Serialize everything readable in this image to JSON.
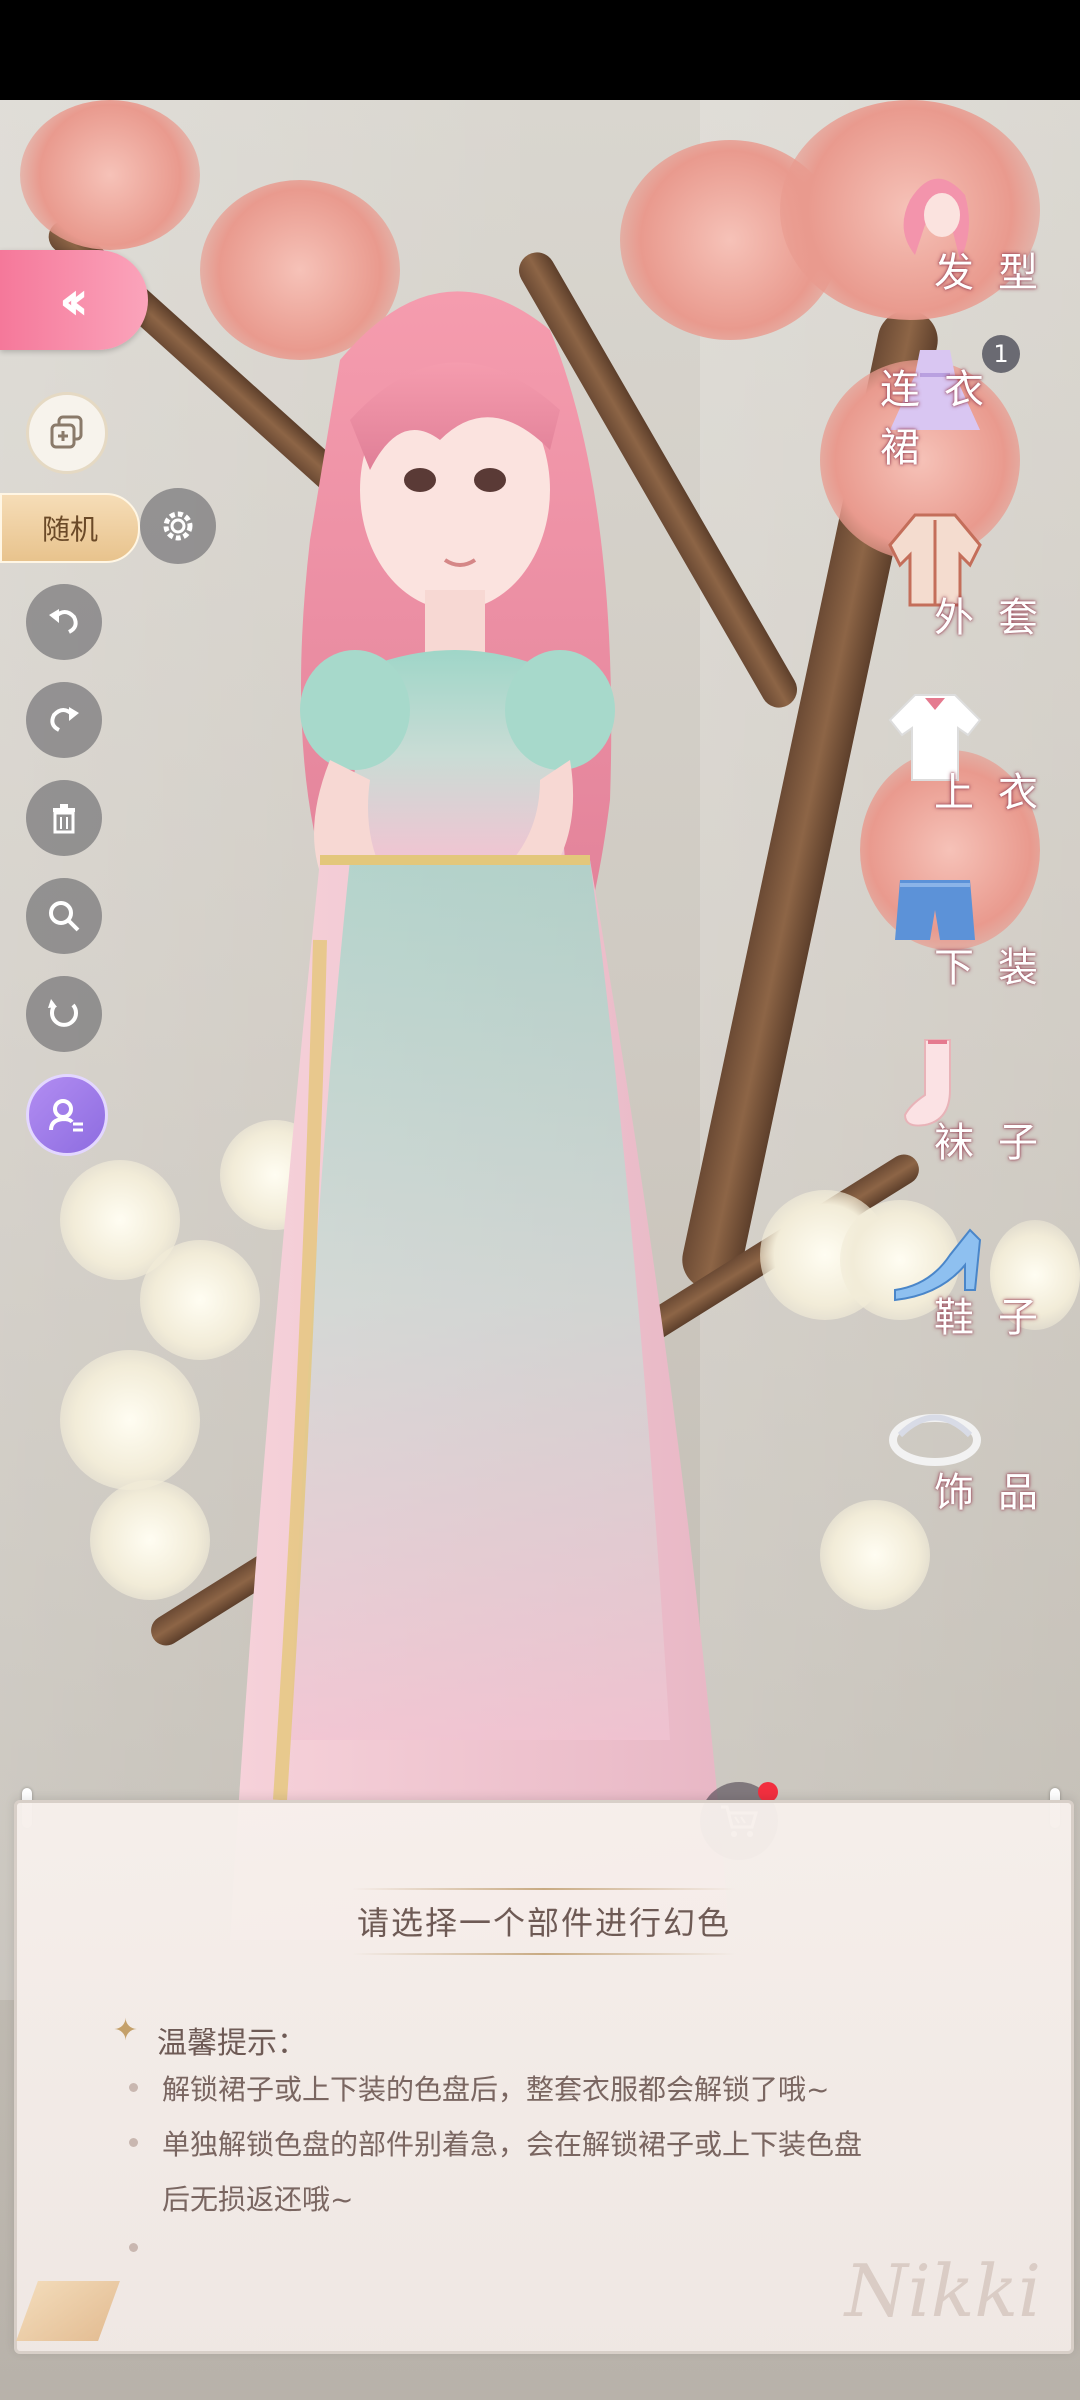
{
  "left_controls": {
    "random_label": "随机"
  },
  "categories": [
    {
      "label": "发型",
      "icon": "hairstyle-icon"
    },
    {
      "label": "连衣裙",
      "icon": "dress-icon",
      "badge": "1"
    },
    {
      "label": "外套",
      "icon": "coat-icon"
    },
    {
      "label": "上衣",
      "icon": "top-icon"
    },
    {
      "label": "下装",
      "icon": "bottoms-icon"
    },
    {
      "label": "袜子",
      "icon": "socks-icon"
    },
    {
      "label": "鞋子",
      "icon": "shoes-icon"
    },
    {
      "label": "饰品",
      "icon": "accessory-icon"
    }
  ],
  "panel": {
    "title": "请选择一个部件进行幻色",
    "tip_heading": "温馨提示：",
    "tips": [
      "解锁裙子或上下装的色盘后，整套衣服都会解锁了哦~",
      "单独解锁色盘的部件别着急，会在解锁裙子或上下装色盘",
      "后无损返还哦~"
    ],
    "signature": "Nikki"
  },
  "colors": {
    "accent_pink": "#f5789a",
    "random_gold": "#e8c38d",
    "cart_dot": "#f22f3f"
  }
}
